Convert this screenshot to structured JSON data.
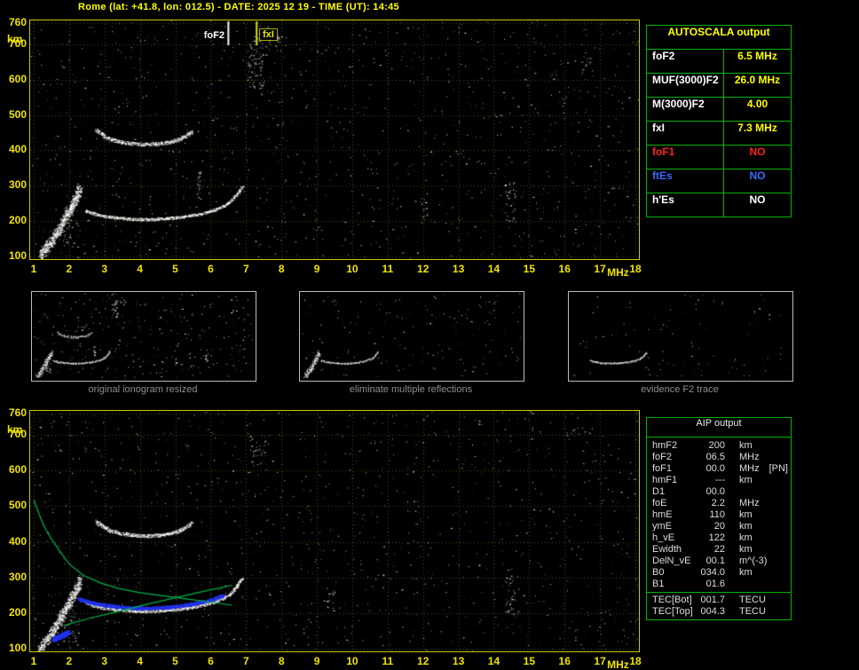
{
  "header": {
    "title": "Rome (lat: +41.8, lon: 012.5) - DATE: 2025 12 19 - TIME (UT): 14:45"
  },
  "colors": {
    "background": "#000000",
    "axis_yellow": "#f0e400",
    "plot_border": "#c8c800",
    "grid": "#4f4f00",
    "trace_white": "#ffffff",
    "table_border_green": "#00b400",
    "value_yellow": "#ffff00",
    "alert_red": "#ff2020",
    "alert_blue": "#3a6aff",
    "profile_green": "#00b44b",
    "scaled_trace_blue": "#2233ee",
    "caption_gray": "#8f8f8f"
  },
  "autoscala_table": {
    "title": "AUTOSCALA output",
    "rows": [
      {
        "label": "foF2",
        "value": "6.5 MHz",
        "label_color": "#ffffff",
        "value_color": "#ffff00"
      },
      {
        "label": "MUF(3000)F2",
        "value": "26.0 MHz",
        "label_color": "#ffffff",
        "value_color": "#ffff00"
      },
      {
        "label": "M(3000)F2",
        "value": "4.00",
        "label_color": "#ffffff",
        "value_color": "#ffff00"
      },
      {
        "label": "fxI",
        "value": "7.3 MHz",
        "label_color": "#ffffff",
        "value_color": "#ffff00"
      },
      {
        "label": "foF1",
        "value": "NO",
        "label_color": "#ff2020",
        "value_color": "#ff2020"
      },
      {
        "label": "ftEs",
        "value": "NO",
        "label_color": "#3a6aff",
        "value_color": "#3a6aff"
      },
      {
        "label": "h'Es",
        "value": "NO",
        "label_color": "#ffffff",
        "value_color": "#ffffff"
      }
    ]
  },
  "thumbnails": {
    "items": [
      {
        "caption": "original ionogram resized",
        "seed": 31,
        "noise": 300,
        "clusters": true,
        "include": [
          "E-region-scatter",
          "F2-trace",
          "F2-second-hop"
        ]
      },
      {
        "caption": "eliminate multiple reflections",
        "seed": 32,
        "noise": 175,
        "clusters": false,
        "include": [
          "E-region-scatter",
          "F2-trace"
        ]
      },
      {
        "caption": "evidence F2 trace",
        "seed": 33,
        "noise": 95,
        "clusters": false,
        "include": [
          "F2-trace"
        ]
      }
    ]
  },
  "aip_table": {
    "title": "AIP output",
    "rows": [
      {
        "label": "hmF2",
        "value": "200",
        "unit": "km",
        "note": ""
      },
      {
        "label": "foF2",
        "value": "06.5",
        "unit": "MHz",
        "note": ""
      },
      {
        "label": "foF1",
        "value": "00.0",
        "unit": "MHz",
        "note": "[PN]"
      },
      {
        "label": "hmF1",
        "value": "---",
        "unit": "km",
        "note": ""
      },
      {
        "label": "D1",
        "value": "00.0",
        "unit": "",
        "note": ""
      },
      {
        "label": "foE",
        "value": "2.2",
        "unit": "MHz",
        "note": ""
      },
      {
        "label": "hmE",
        "value": "110",
        "unit": "km",
        "note": ""
      },
      {
        "label": "ymE",
        "value": "20",
        "unit": "km",
        "note": ""
      },
      {
        "label": "h_vE",
        "value": "122",
        "unit": "km",
        "note": ""
      },
      {
        "label": "Ewidth",
        "value": "22",
        "unit": "km",
        "note": ""
      },
      {
        "label": "DelN_vE",
        "value": "00.1",
        "unit": "m^(-3)",
        "note": ""
      },
      {
        "label": "B0",
        "value": "034.0",
        "unit": "km",
        "note": ""
      },
      {
        "label": "B1",
        "value": "01.6",
        "unit": "",
        "note": ""
      }
    ],
    "tec_rows": [
      {
        "label": "TEC[Bot]",
        "value": "001.7",
        "unit": "TECU"
      },
      {
        "label": "TEC[Top]",
        "value": "004.3",
        "unit": "TECU"
      }
    ]
  },
  "chart_data": [
    {
      "type": "scatter",
      "title": "Ionogram with AUTOSCALA scaled frequencies",
      "xlabel": "MHz",
      "ylabel": "km",
      "xlim": [
        1,
        18
      ],
      "ylim": [
        100,
        760
      ],
      "xticks": [
        1,
        2,
        3,
        4,
        5,
        6,
        7,
        8,
        9,
        10,
        11,
        12,
        13,
        14,
        15,
        16,
        17,
        18
      ],
      "yticks": [
        100,
        200,
        300,
        400,
        500,
        600,
        700,
        760
      ],
      "grid": true,
      "markers": [
        {
          "name": "foF2",
          "x": 6.5,
          "color": "#ffffff"
        },
        {
          "name": "fxI",
          "x": 7.3,
          "color": "#e0e000"
        }
      ],
      "series": [
        {
          "name": "E-region-scatter",
          "color": "#ffffff",
          "density": 3,
          "jx": 3,
          "jy": 5,
          "points": [
            [
              1.15,
              100
            ],
            [
              1.3,
              118
            ],
            [
              1.45,
              138
            ],
            [
              1.6,
              160
            ],
            [
              1.75,
              185
            ],
            [
              1.9,
              212
            ],
            [
              2.05,
              240
            ],
            [
              2.2,
              268
            ],
            [
              2.3,
              295
            ]
          ]
        },
        {
          "name": "F2-trace",
          "color": "#ffffff",
          "density": 3,
          "jx": 1.5,
          "jy": 1.5,
          "points": [
            [
              2.45,
              230
            ],
            [
              2.7,
              221
            ],
            [
              3.0,
              214
            ],
            [
              3.4,
              209
            ],
            [
              3.8,
              206
            ],
            [
              4.2,
              205
            ],
            [
              4.6,
              207
            ],
            [
              5.0,
              210
            ],
            [
              5.4,
              215
            ],
            [
              5.8,
              223
            ],
            [
              6.1,
              232
            ],
            [
              6.4,
              245
            ],
            [
              6.6,
              260
            ],
            [
              6.75,
              278
            ],
            [
              6.88,
              298
            ]
          ]
        },
        {
          "name": "F2-second-hop",
          "color": "#ffffff",
          "density": 2,
          "jx": 1.5,
          "jy": 2,
          "points": [
            [
              2.75,
              458
            ],
            [
              2.95,
              443
            ],
            [
              3.15,
              432
            ],
            [
              3.45,
              424
            ],
            [
              3.8,
              419
            ],
            [
              4.15,
              417
            ],
            [
              4.5,
              419
            ],
            [
              4.85,
              424
            ],
            [
              5.1,
              432
            ],
            [
              5.3,
              442
            ],
            [
              5.45,
              454
            ]
          ]
        }
      ],
      "noise": {
        "seed": 11,
        "count": 1250,
        "clusters": [
          {
            "f": 7.25,
            "km": 645,
            "df": 0.22,
            "dkm": 70,
            "n": 85
          },
          {
            "f": 7.7,
            "km": 705,
            "df": 0.45,
            "dkm": 25,
            "n": 25
          },
          {
            "f": 2.0,
            "km": 185,
            "df": 0.25,
            "dkm": 60,
            "n": 55
          },
          {
            "f": 5.65,
            "km": 305,
            "df": 0.05,
            "dkm": 42,
            "n": 28
          },
          {
            "f": 14.45,
            "km": 255,
            "df": 0.15,
            "dkm": 55,
            "n": 38
          },
          {
            "f": 12.05,
            "km": 235,
            "df": 0.1,
            "dkm": 30,
            "n": 14
          },
          {
            "f": 16.6,
            "km": 645,
            "df": 0.2,
            "dkm": 30,
            "n": 14
          }
        ]
      }
    },
    {
      "type": "scatter",
      "title": "Ionogram with AIP inverted profile",
      "xlabel": "MHz",
      "ylabel": "km",
      "xlim": [
        1,
        18
      ],
      "ylim": [
        100,
        760
      ],
      "xticks": [
        1,
        2,
        3,
        4,
        5,
        6,
        7,
        8,
        9,
        10,
        11,
        12,
        13,
        14,
        15,
        16,
        17,
        18
      ],
      "yticks": [
        100,
        200,
        300,
        400,
        500,
        600,
        700,
        760
      ],
      "grid": true,
      "markers": [],
      "series": [
        {
          "name": "E-region-scatter",
          "color": "#ffffff",
          "density": 3,
          "jx": 3,
          "jy": 5,
          "points": [
            [
              1.15,
              100
            ],
            [
              1.3,
              118
            ],
            [
              1.45,
              138
            ],
            [
              1.6,
              160
            ],
            [
              1.75,
              185
            ],
            [
              1.9,
              212
            ],
            [
              2.05,
              240
            ],
            [
              2.2,
              268
            ],
            [
              2.3,
              295
            ]
          ]
        },
        {
          "name": "F2-trace",
          "color": "#ffffff",
          "density": 3,
          "jx": 1.5,
          "jy": 1.5,
          "points": [
            [
              2.45,
              230
            ],
            [
              2.7,
              221
            ],
            [
              3.0,
              214
            ],
            [
              3.4,
              209
            ],
            [
              3.8,
              206
            ],
            [
              4.2,
              205
            ],
            [
              4.6,
              207
            ],
            [
              5.0,
              210
            ],
            [
              5.4,
              215
            ],
            [
              5.8,
              223
            ],
            [
              6.1,
              232
            ],
            [
              6.4,
              245
            ],
            [
              6.6,
              260
            ],
            [
              6.75,
              278
            ],
            [
              6.88,
              298
            ]
          ]
        },
        {
          "name": "F2-second-hop",
          "color": "#ffffff",
          "density": 2,
          "jx": 1.5,
          "jy": 2,
          "points": [
            [
              2.75,
              458
            ],
            [
              2.95,
              443
            ],
            [
              3.15,
              432
            ],
            [
              3.45,
              424
            ],
            [
              3.8,
              419
            ],
            [
              4.15,
              417
            ],
            [
              4.5,
              419
            ],
            [
              4.85,
              424
            ],
            [
              5.1,
              432
            ],
            [
              5.3,
              442
            ],
            [
              5.45,
              454
            ]
          ]
        },
        {
          "name": "scaled-F2-trace",
          "color": "#2233ee",
          "size": 2,
          "density": 3,
          "jx": 1.5,
          "jy": 1.5,
          "points": [
            [
              2.25,
              242
            ],
            [
              2.6,
              231
            ],
            [
              3.0,
              224
            ],
            [
              3.4,
              219
            ],
            [
              3.8,
              216
            ],
            [
              4.2,
              215
            ],
            [
              4.6,
              217
            ],
            [
              5.0,
              220
            ],
            [
              5.4,
              226
            ],
            [
              5.8,
              234
            ],
            [
              6.1,
              242
            ],
            [
              6.35,
              252
            ]
          ]
        },
        {
          "name": "scaled-E-trace",
          "color": "#2233ee",
          "size": 2,
          "density": 2,
          "jx": 2,
          "jy": 2,
          "points": [
            [
              1.55,
              128
            ],
            [
              1.75,
              137
            ],
            [
              1.95,
              147
            ]
          ]
        },
        {
          "name": "electron-density-profile",
          "color": "#00b44b",
          "style": "line",
          "points": [
            [
              1.0,
              518
            ],
            [
              1.15,
              478
            ],
            [
              1.3,
              442
            ],
            [
              1.5,
              408
            ],
            [
              1.75,
              372
            ],
            [
              2.0,
              338
            ],
            [
              2.4,
              306
            ],
            [
              2.9,
              284
            ],
            [
              3.4,
              269
            ],
            [
              4.0,
              257
            ],
            [
              4.7,
              248
            ],
            [
              5.3,
              240
            ],
            [
              5.9,
              232
            ],
            [
              6.6,
              222
            ]
          ]
        },
        {
          "name": "layer-boundary-line",
          "color": "#00b44b",
          "style": "line",
          "points": [
            [
              1.85,
              165
            ],
            [
              2.6,
              186
            ],
            [
              3.4,
              205
            ],
            [
              4.2,
              225
            ],
            [
              5.0,
              243
            ],
            [
              5.8,
              261
            ],
            [
              6.6,
              278
            ]
          ]
        }
      ],
      "noise": {
        "seed": 23,
        "count": 1150,
        "clusters": [
          {
            "f": 14.45,
            "km": 250,
            "df": 0.15,
            "dkm": 58,
            "n": 42
          },
          {
            "f": 7.3,
            "km": 645,
            "df": 0.25,
            "dkm": 55,
            "n": 35
          },
          {
            "f": 2.0,
            "km": 168,
            "df": 0.3,
            "dkm": 55,
            "n": 45
          },
          {
            "f": 9.4,
            "km": 232,
            "df": 0.12,
            "dkm": 32,
            "n": 16
          },
          {
            "f": 16.3,
            "km": 700,
            "df": 0.3,
            "dkm": 22,
            "n": 12
          }
        ]
      }
    }
  ]
}
